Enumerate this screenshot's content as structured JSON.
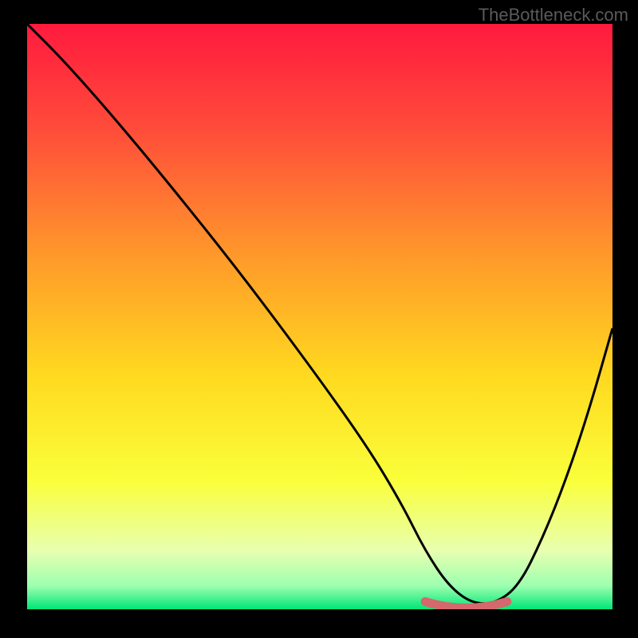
{
  "watermark": "TheBottleneck.com",
  "chart_data": {
    "type": "line",
    "title": "",
    "xlabel": "",
    "ylabel": "",
    "xlim": [
      0,
      100
    ],
    "ylim": [
      0,
      100
    ],
    "gradient_stops": [
      {
        "offset": 0,
        "color": "#ff1a3e"
      },
      {
        "offset": 18,
        "color": "#ff4c3a"
      },
      {
        "offset": 40,
        "color": "#ff9a2a"
      },
      {
        "offset": 60,
        "color": "#ffd91f"
      },
      {
        "offset": 78,
        "color": "#faff3a"
      },
      {
        "offset": 90,
        "color": "#e8ffb0"
      },
      {
        "offset": 96,
        "color": "#9dffb0"
      },
      {
        "offset": 100,
        "color": "#00e676"
      }
    ],
    "series": [
      {
        "name": "bottleneck-curve",
        "color": "#000000",
        "x": [
          0,
          6,
          14,
          24,
          36,
          48,
          58,
          64,
          68,
          72,
          76,
          80,
          84,
          88,
          92,
          96,
          100
        ],
        "y": [
          100,
          94,
          85,
          73,
          58,
          42,
          28,
          18,
          10,
          4,
          1,
          1,
          4,
          12,
          22,
          34,
          48
        ]
      }
    ],
    "highlight": {
      "color": "#d4686c",
      "x_range": [
        68,
        82
      ],
      "y": 0.5
    }
  }
}
